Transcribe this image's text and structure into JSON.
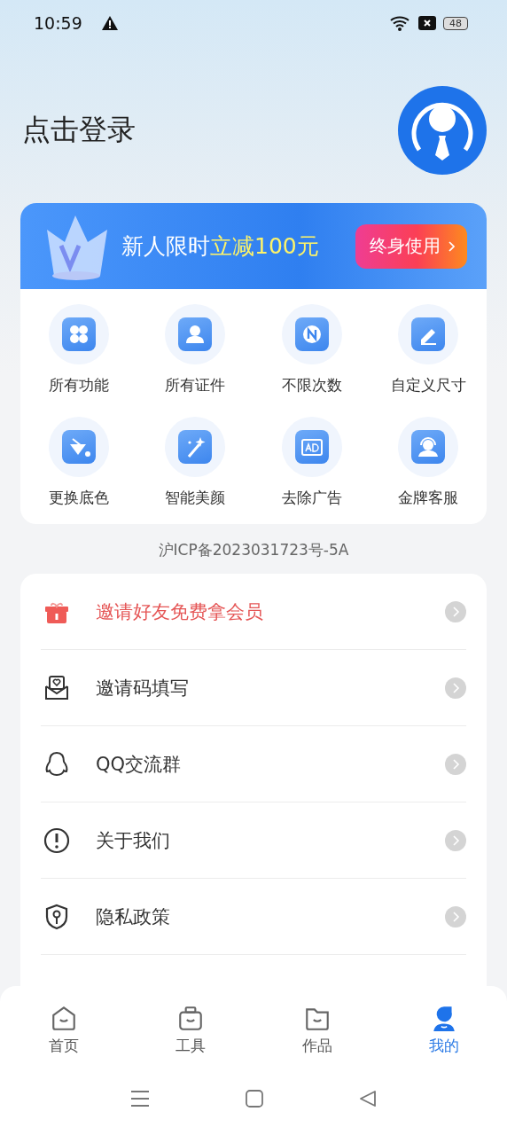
{
  "status_bar": {
    "time": "10:59",
    "battery": "48"
  },
  "header": {
    "login": "点击登录"
  },
  "promo": {
    "lead": "新人限时",
    "highlight": "立减100元",
    "button": "终身使用"
  },
  "features": [
    {
      "label": "所有功能"
    },
    {
      "label": "所有证件"
    },
    {
      "label": "不限次数"
    },
    {
      "label": "自定义尺寸"
    },
    {
      "label": "更换底色"
    },
    {
      "label": "智能美颜"
    },
    {
      "label": "去除广告"
    },
    {
      "label": "金牌客服"
    }
  ],
  "icp": "沪ICP备2023031723号-5A",
  "menu": [
    {
      "label": "邀请好友免费拿会员",
      "kind": "promo"
    },
    {
      "label": "邀请码填写",
      "kind": "normal"
    },
    {
      "label": "QQ交流群",
      "kind": "normal"
    },
    {
      "label": "关于我们",
      "kind": "normal"
    },
    {
      "label": "隐私政策",
      "kind": "normal"
    }
  ],
  "tabs": [
    {
      "label": "首页",
      "selected": false
    },
    {
      "label": "工具",
      "selected": false
    },
    {
      "label": "作品",
      "selected": false
    },
    {
      "label": "我的",
      "selected": true
    }
  ]
}
